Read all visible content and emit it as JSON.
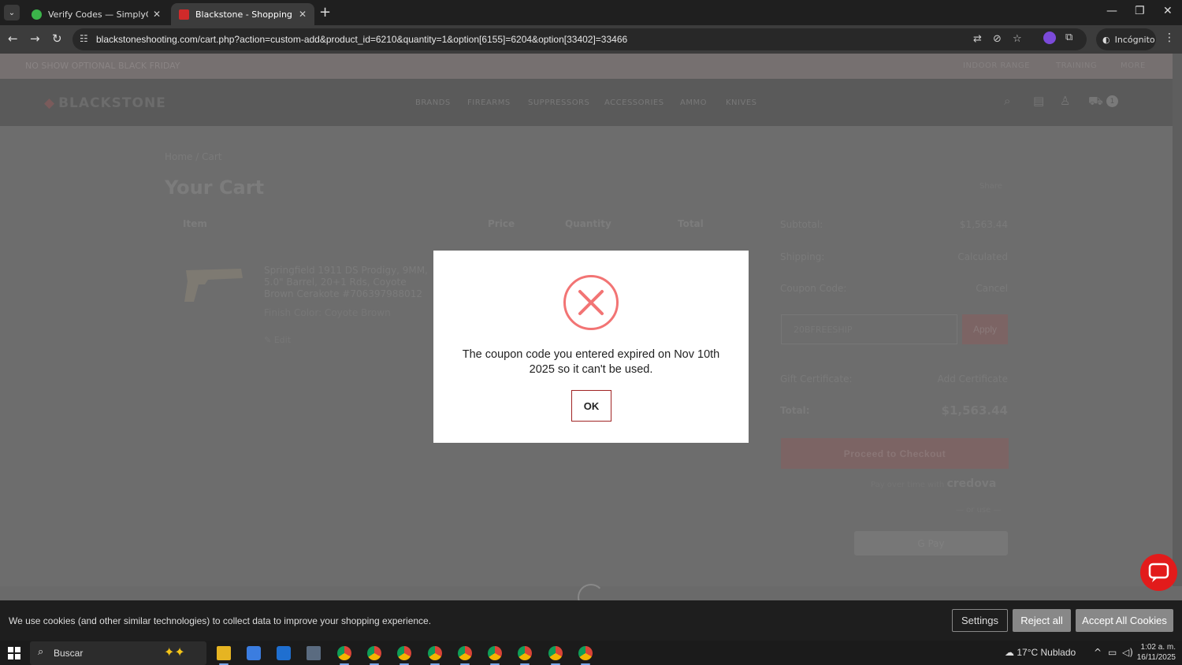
{
  "browser": {
    "tabs": [
      {
        "title": "Verify Codes — SimplyCodes",
        "favicon_color": "#3bb54a"
      },
      {
        "title": "Blackstone - Shopping Cart",
        "favicon_color": "#d02a2a"
      }
    ],
    "url": "blackstoneshooting.com/cart.php?action=custom-add&product_id=6210&quantity=1&option[6155]=6204&option[33402]=33466",
    "incognito_label": "Incógnito"
  },
  "site": {
    "promo_text": "NO SHOW OPTIONAL BLACK FRIDAY",
    "top_links": [
      "INDOOR RANGE",
      "TRAINING",
      "MORE"
    ],
    "logo_text": "BLACKSTONE",
    "nav": [
      "BRANDS",
      "FIREARMS",
      "SUPPRESSORS",
      "ACCESSORIES",
      "AMMO",
      "KNIVES"
    ],
    "cart_count": "1"
  },
  "cart": {
    "breadcrumb": "Home / Cart",
    "title": "Your Cart",
    "share_label": "Share",
    "columns": [
      "Item",
      "Price",
      "Quantity",
      "Total"
    ],
    "item": {
      "name": "Springfield 1911 DS Prodigy, 9MM, 5.0\" Barrel, 20+1 Rds, Coyote Brown Cerakote #706397988012",
      "option": "Finish Color: Coyote Brown",
      "edit_label": "Edit"
    },
    "summary": {
      "subtotal_label": "Subtotal:",
      "subtotal_value": "$1,563.44",
      "shipping_label": "Shipping:",
      "shipping_value": "Calculated",
      "coupon_label": "Coupon Code:",
      "coupon_action": "Cancel",
      "coupon_input_value": "20BFREESHIP",
      "apply_label": "Apply",
      "gift_label": "Gift Certificate:",
      "gift_action": "Add Certificate",
      "total_label": "Total:",
      "total_value": "$1,563.44",
      "checkout_label": "Proceed to Checkout",
      "credova_text": "Pay over time with",
      "credova_brand": "credova",
      "or_pay": "— or use —",
      "gpay_label": "G Pay"
    }
  },
  "modal": {
    "message": "The coupon code you entered expired on Nov 10th 2025 so it can't be used.",
    "ok_label": "OK",
    "icon_color": "#f27474"
  },
  "cookie_bar": {
    "text": "We use cookies (and other similar technologies) to collect data to improve your shopping experience.",
    "settings_label": "Settings",
    "reject_label": "Reject all",
    "accept_label": "Accept All Cookies"
  },
  "taskbar": {
    "search_label": "Buscar",
    "weather": "17°C  Nublado",
    "time": "1:02 a. m.",
    "date": "16/11/2025",
    "app_icons": [
      "file-explorer-icon",
      "store-icon",
      "outlook-icon",
      "calculator-icon",
      "chrome-icon",
      "chrome-icon",
      "chrome-icon",
      "chrome-icon",
      "chrome-icon",
      "chrome-icon",
      "chrome-icon",
      "chrome-icon",
      "chrome-icon"
    ]
  }
}
